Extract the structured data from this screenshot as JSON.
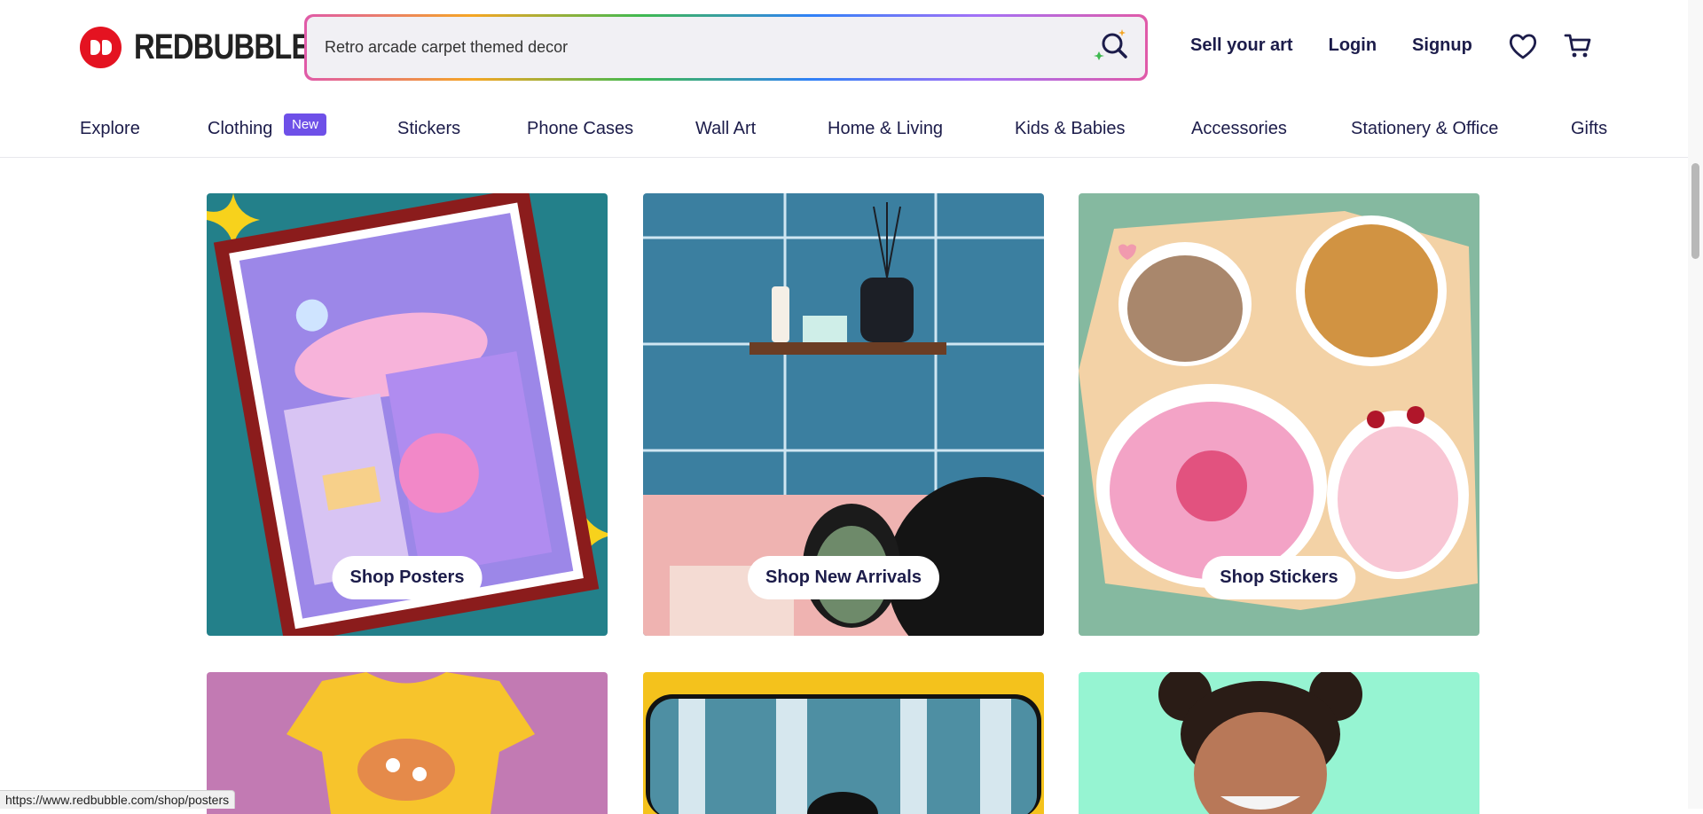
{
  "brand": {
    "name": "REDBUBBLE",
    "color": "#e41321"
  },
  "search": {
    "value": "Retro arcade carpet themed decor"
  },
  "header": {
    "links": [
      "Sell your art",
      "Login",
      "Signup"
    ],
    "icons": [
      "heart-icon",
      "cart-icon"
    ]
  },
  "nav": {
    "items": [
      "Explore",
      "Clothing",
      "Stickers",
      "Phone Cases",
      "Wall Art",
      "Home & Living",
      "Kids & Babies",
      "Accessories",
      "Stationery & Office",
      "Gifts"
    ],
    "badge": "New"
  },
  "cards": [
    {
      "button": "Shop Posters"
    },
    {
      "button": "Shop New Arrivals"
    },
    {
      "button": "Shop Stickers"
    }
  ],
  "status_url": "https://www.redbubble.com/shop/posters",
  "colors": {
    "accent": "#6e50e8",
    "text": "#1c1c4a"
  }
}
